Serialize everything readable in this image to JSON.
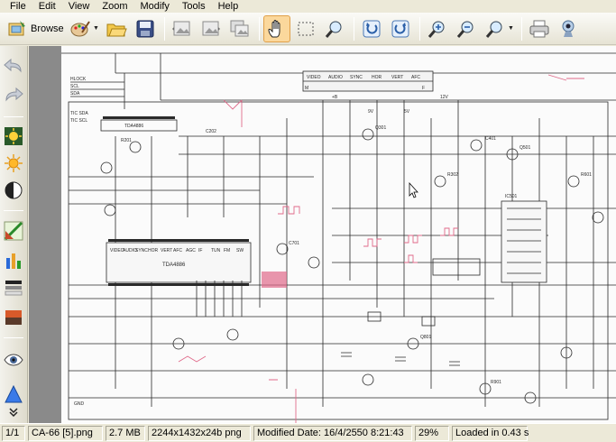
{
  "menu": [
    "File",
    "Edit",
    "View",
    "Zoom",
    "Modify",
    "Tools",
    "Help"
  ],
  "toolbar": {
    "browse_label": "Browse"
  },
  "status": {
    "page": "1/1",
    "filename": "CA-66 [5].png",
    "filesize": "2.7 MB",
    "dimensions": "2244x1432x24b png",
    "modified": "Modified Date: 16/4/2550 8:21:43",
    "zoom": "29%",
    "load_time": "Loaded in 0.43 s"
  },
  "schematic": {
    "ic_main": "TDA4886",
    "ic_main_pin_labels": [
      "VIDEO",
      "AUDIO",
      "SYNC",
      "HOR",
      "VERT",
      "AFC",
      "AGC",
      "IF",
      "TUN",
      "FM",
      "SW"
    ],
    "ic_small": "TDA4886",
    "connector_labels": [
      "VIDEO",
      "AUDIO",
      "SYNC",
      "HOR",
      "VERT",
      "AFC"
    ],
    "part_labels": [
      "HLOCK",
      "SCL",
      "SDA",
      "TIC SDA",
      "TIC SCL",
      "R201",
      "C202",
      "Q301",
      "R302",
      "C401",
      "Q501",
      "R601",
      "C701",
      "Q801",
      "R901",
      "IC501",
      "+B",
      "12V",
      "9V",
      "5V",
      "GND",
      "M",
      "F"
    ]
  },
  "colors": {
    "toolbar_active": "#fbd89c",
    "schematic_ink": "#2a2a2a",
    "schematic_red": "#e06a8a",
    "viewer_bg": "#8a8a8a"
  },
  "icons": {
    "toolbar": [
      "browse-icon",
      "palette-icon",
      "open-folder-icon",
      "save-disk-icon",
      "image-prev-icon",
      "image-next-icon",
      "slideshow-icon",
      "hand-pan-icon",
      "select-rect-icon",
      "magnifier-icon",
      "rotate-left-icon",
      "rotate-right-icon",
      "zoom-in-icon",
      "zoom-out-icon",
      "zoom-dropdown-icon",
      "printer-icon",
      "webcam-icon"
    ],
    "sidebar": [
      "undo-icon",
      "redo-icon",
      "brightness-icon",
      "sun-icon",
      "contrast-icon",
      "color-balance-icon",
      "histogram-icon",
      "hue-icon",
      "swatch-icon",
      "eye-icon",
      "sharpen-icon",
      "more-icon"
    ]
  }
}
